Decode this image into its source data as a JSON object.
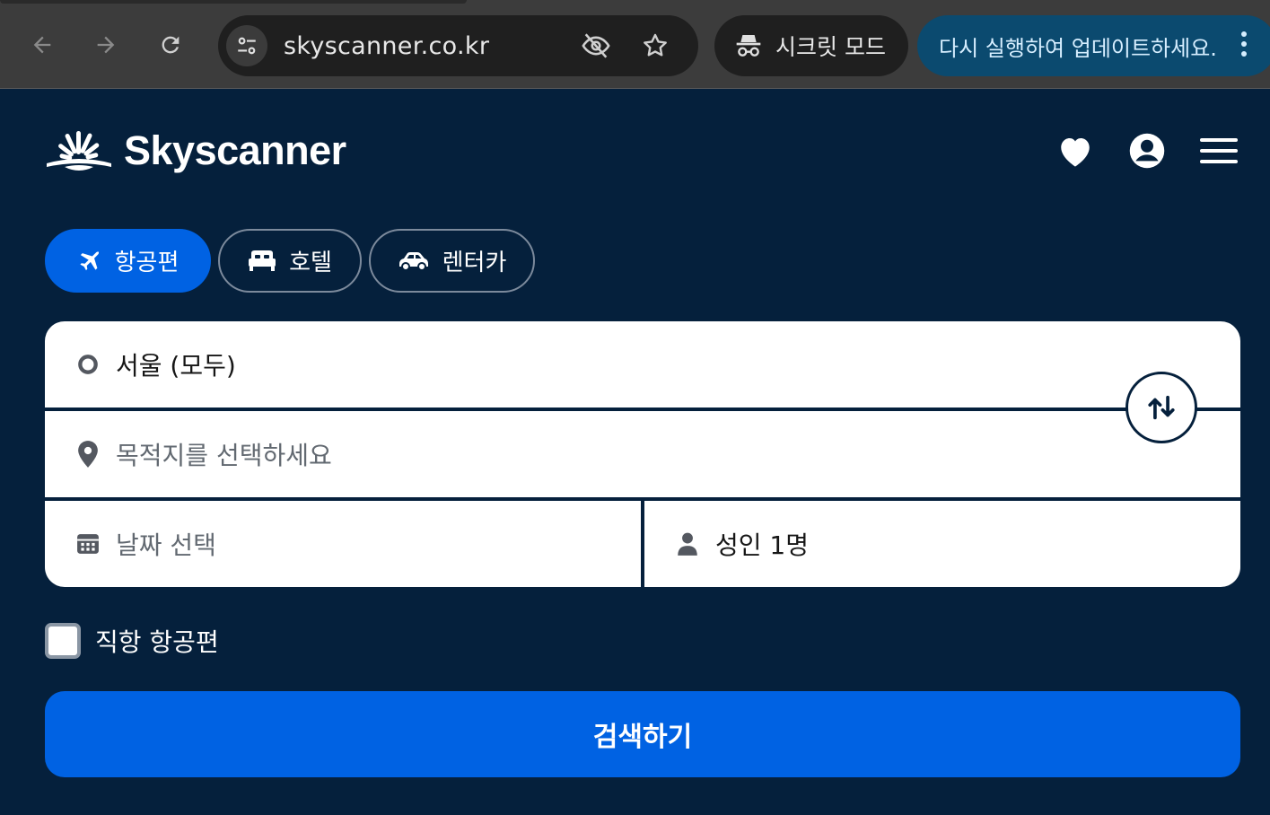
{
  "browser": {
    "url": "skyscanner.co.kr",
    "incognito_label": "시크릿 모드",
    "update_label": "다시 실행하여 업데이트하세요.",
    "icons": {
      "back": "arrow-left-icon",
      "forward": "arrow-right-icon",
      "reload": "reload-icon",
      "site_info": "tune-icon",
      "tracking": "eye-off-icon",
      "bookmark": "star-icon",
      "incognito": "incognito-icon",
      "menu": "kebab-menu-icon"
    }
  },
  "header": {
    "logo_text": "Skyscanner",
    "icons": [
      "heart-icon",
      "account-icon",
      "hamburger-menu-icon"
    ]
  },
  "verticals": [
    {
      "label": "항공편",
      "icon": "plane-icon",
      "active": true
    },
    {
      "label": "호텔",
      "icon": "bed-icon",
      "active": false
    },
    {
      "label": "렌터카",
      "icon": "car-icon",
      "active": false
    }
  ],
  "search": {
    "origin_value": "서울 (모두)",
    "destination_placeholder": "목적지를 선택하세요",
    "date_placeholder": "날짜 선택",
    "travellers_value": "성인 1명",
    "direct_label": "직항 항공편",
    "direct_checked": false,
    "submit_label": "검색하기"
  },
  "colors": {
    "page_bg": "#05203c",
    "accent": "#0062e3",
    "chrome_bg": "#3c3c3c",
    "update_chip": "#0b4a6f"
  }
}
